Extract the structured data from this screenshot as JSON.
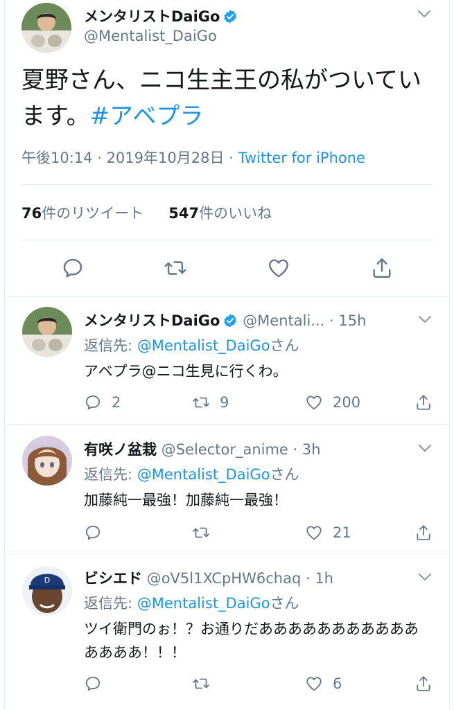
{
  "main_tweet": {
    "display_name": "メンタリストDaiGo",
    "handle": "@Mentalist_DaiGo",
    "text_plain": "夏野さん、ニコ生主王の私がついています。",
    "hashtag": "#アベプラ",
    "time": "午後10:14",
    "sep": " · ",
    "date": "2019年10月28日",
    "sep2": " · ",
    "client": "Twitter for iPhone",
    "retweets_count": "76",
    "retweets_label": "件のリツイート",
    "likes_count": "547",
    "likes_label": "件のいいね",
    "icons": [
      "reply-icon",
      "retweet-icon",
      "like-icon",
      "share-icon"
    ]
  },
  "replies": [
    {
      "display_name": "メンタリストDaiGo",
      "verified": true,
      "handle": "@Mentali...",
      "time": "· 15h",
      "reply_to_label": "返信先: ",
      "reply_to_handle": "@Mentalist_DaiGo",
      "reply_to_suffix": "さん",
      "text": "アベプラ@ニコ生見に行くわ。",
      "reply_count": "2",
      "retweet_count": "9",
      "like_count": "200"
    },
    {
      "display_name": "有咲ノ盆栽",
      "verified": false,
      "handle": "@Selector_anime",
      "time": "· 3h",
      "reply_to_label": "返信先: ",
      "reply_to_handle": "@Mentalist_DaiGo",
      "reply_to_suffix": "さん",
      "text": "加藤純一最強！加藤純一最強！",
      "reply_count": "",
      "retweet_count": "",
      "like_count": "21"
    },
    {
      "display_name": "ビシエド",
      "verified": false,
      "handle": "@oV5l1XCpHW6chaq",
      "time": "· 1h",
      "reply_to_label": "返信先: ",
      "reply_to_handle": "@Mentalist_DaiGo",
      "reply_to_suffix": "さん",
      "text": "ツイ衛門のぉ！？お通りだあああああああああああああああ！！！",
      "reply_count": "",
      "retweet_count": "",
      "like_count": "6"
    }
  ],
  "colors": {
    "link": "#1b95e0",
    "secondary": "#657786",
    "text": "#14171a",
    "divider": "#e6ecf0",
    "verified": "#1da1f2"
  }
}
